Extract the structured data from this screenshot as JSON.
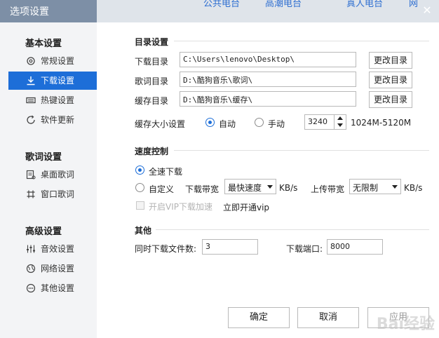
{
  "window": {
    "title": "选项设置",
    "close_glyph": "✕"
  },
  "background_tabs": [
    "公共电台",
    "高潮电台",
    "真人电台",
    "网"
  ],
  "sidebar": {
    "groups": [
      {
        "title": "基本设置",
        "items": [
          {
            "label": "常规设置",
            "icon": "gear-icon"
          },
          {
            "label": "下载设置",
            "icon": "download-icon",
            "active": true
          },
          {
            "label": "热键设置",
            "icon": "keyboard-icon"
          },
          {
            "label": "软件更新",
            "icon": "refresh-icon"
          }
        ]
      },
      {
        "title": "歌词设置",
        "items": [
          {
            "label": "桌面歌词",
            "icon": "desktop-lyrics-icon"
          },
          {
            "label": "窗口歌词",
            "icon": "window-lyrics-icon"
          }
        ]
      },
      {
        "title": "高级设置",
        "items": [
          {
            "label": "音效设置",
            "icon": "equalizer-icon"
          },
          {
            "label": "网络设置",
            "icon": "globe-icon"
          },
          {
            "label": "其他设置",
            "icon": "more-icon"
          }
        ]
      }
    ]
  },
  "directory": {
    "section_title": "目录设置",
    "download_label": "下载目录",
    "download_path": "C:\\Users\\lenovo\\Desktop\\",
    "lyrics_label": "歌词目录",
    "lyrics_path": "D:\\酷狗音乐\\歌词\\",
    "cache_label": "缓存目录",
    "cache_path": "D:\\酷狗音乐\\缓存\\",
    "change_button": "更改目录",
    "cache_size_label": "缓存大小设置",
    "auto_label": "自动",
    "manual_label": "手动",
    "cache_size_value": "3240",
    "cache_range": "1024M-5120M"
  },
  "speed": {
    "section_title": "速度控制",
    "full_speed_label": "全速下载",
    "custom_label": "自定义",
    "download_bw_label": "下载带宽",
    "download_bw_value": "最快速度",
    "unit": "KB/s",
    "upload_bw_label": "上传带宽",
    "upload_bw_value": "无限制",
    "vip_accel_label": "开启VIP下载加速",
    "vip_link": "立即开通vip"
  },
  "other": {
    "section_title": "其他",
    "concurrent_label": "同时下载文件数:",
    "concurrent_value": "3",
    "port_label": "下载端口:",
    "port_value": "8000"
  },
  "footer": {
    "ok": "确定",
    "cancel": "取消",
    "apply": "应用"
  },
  "watermark": "Bai经验",
  "colors": {
    "accent": "#1d6ed8",
    "sidebar_bg": "#f3f4f6",
    "titlebar_bg": "#7d8fa6"
  }
}
